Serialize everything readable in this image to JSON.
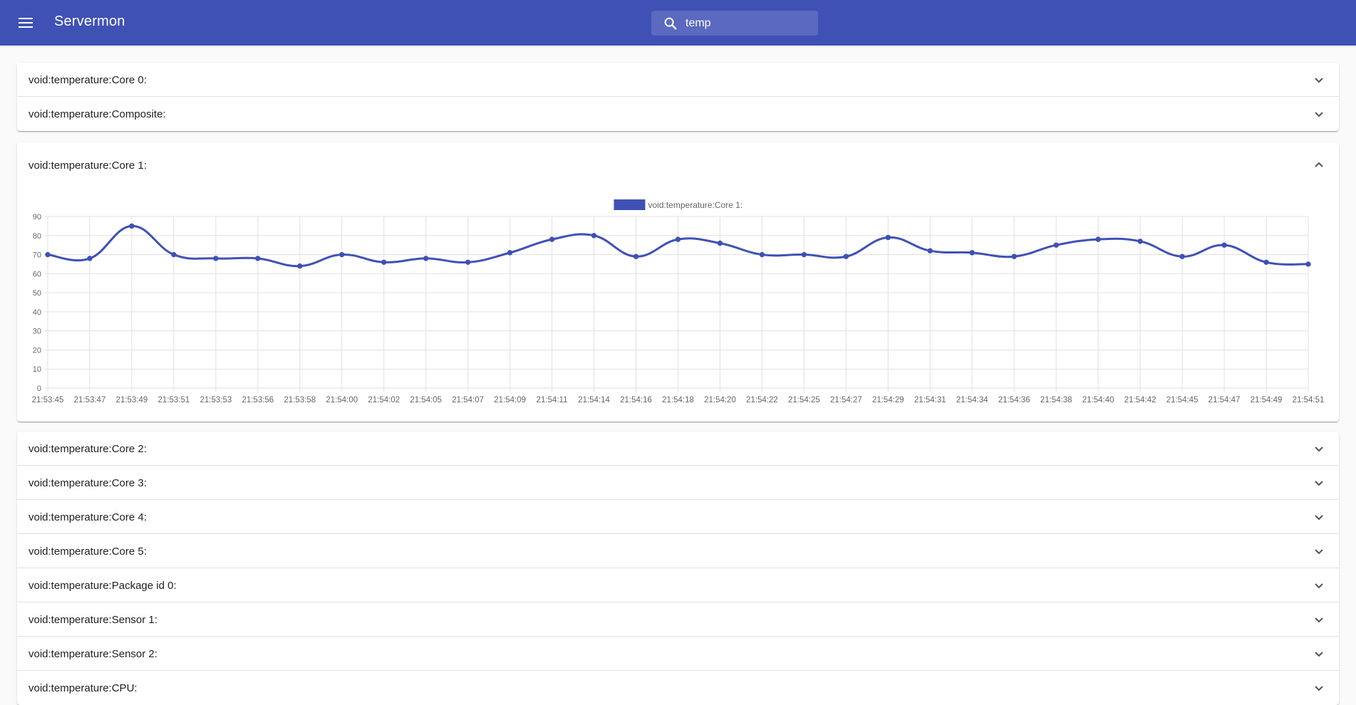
{
  "app": {
    "title": "Servermon"
  },
  "search": {
    "value": "temp"
  },
  "panels_top": [
    {
      "label": "void:temperature:Core 0:"
    },
    {
      "label": "void:temperature:Composite:"
    }
  ],
  "expanded_panel": {
    "label": "void:temperature:Core 1:"
  },
  "panels_bottom": [
    {
      "label": "void:temperature:Core 2:"
    },
    {
      "label": "void:temperature:Core 3:"
    },
    {
      "label": "void:temperature:Core 4:"
    },
    {
      "label": "void:temperature:Core 5:"
    },
    {
      "label": "void:temperature:Package id 0:"
    },
    {
      "label": "void:temperature:Sensor 1:"
    },
    {
      "label": "void:temperature:Sensor 2:"
    },
    {
      "label": "void:temperature:CPU:"
    }
  ],
  "colors": {
    "primary": "#3f51b5",
    "grid": "#e0e0e0",
    "text": "#666666"
  },
  "chart_data": {
    "type": "line",
    "title": "",
    "xlabel": "",
    "ylabel": "",
    "ylim": [
      0,
      90
    ],
    "yticks": [
      0,
      10,
      20,
      30,
      40,
      50,
      60,
      70,
      80,
      90
    ],
    "grid": true,
    "legend": "top-center",
    "categories": [
      "21:53:45",
      "21:53:47",
      "21:53:49",
      "21:53:51",
      "21:53:53",
      "21:53:56",
      "21:53:58",
      "21:54:00",
      "21:54:02",
      "21:54:05",
      "21:54:07",
      "21:54:09",
      "21:54:11",
      "21:54:14",
      "21:54:16",
      "21:54:18",
      "21:54:20",
      "21:54:22",
      "21:54:25",
      "21:54:27",
      "21:54:29",
      "21:54:31",
      "21:54:34",
      "21:54:36",
      "21:54:38",
      "21:54:40",
      "21:54:42",
      "21:54:45",
      "21:54:47",
      "21:54:49",
      "21:54:51"
    ],
    "series": [
      {
        "name": "void:temperature:Core 1:",
        "color": "#3f51b5",
        "values": [
          70,
          68,
          85,
          70,
          68,
          68,
          64,
          70,
          66,
          68,
          66,
          71,
          78,
          80,
          69,
          78,
          76,
          70,
          70,
          69,
          79,
          72,
          71,
          69,
          75,
          78,
          77,
          69,
          75,
          66,
          65
        ]
      }
    ]
  }
}
